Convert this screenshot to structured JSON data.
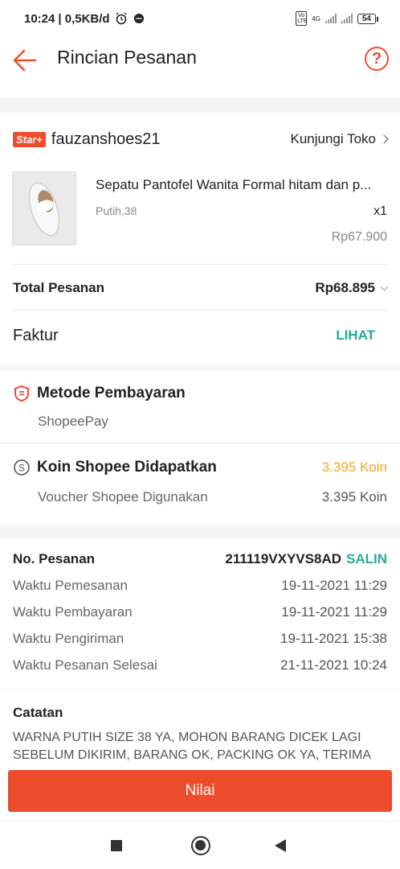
{
  "status_bar": {
    "time": "10:24",
    "speed": "| 0,5KB/d",
    "network": "4G",
    "volte": "Vo LTE",
    "battery": "54"
  },
  "app_bar": {
    "title": "Rincian Pesanan",
    "help": "?"
  },
  "shop": {
    "badge": "Star+",
    "name": "fauzanshoes21",
    "visit_label": "Kunjungi Toko"
  },
  "product": {
    "name": "Sepatu Pantofel Wanita Formal hitam dan p...",
    "variant": "Putih,38",
    "quantity": "x1",
    "price": "Rp67.900"
  },
  "total": {
    "label": "Total Pesanan",
    "value": "Rp68.895"
  },
  "invoice": {
    "label": "Faktur",
    "action": "LIHAT"
  },
  "payment": {
    "title": "Metode Pembayaran",
    "method": "ShopeePay"
  },
  "coins": {
    "title": "Koin Shopee Didapatkan",
    "earned": "3.395 Koin",
    "voucher_label": "Voucher Shopee Digunakan",
    "voucher_value": "3.395 Koin"
  },
  "order_info": {
    "number_label": "No. Pesanan",
    "number_value": "211119VXYVS8AD",
    "copy_label": "SALIN",
    "rows": [
      {
        "label": "Waktu Pemesanan",
        "value": "19-11-2021 11:29"
      },
      {
        "label": "Waktu Pembayaran",
        "value": "19-11-2021 11:29"
      },
      {
        "label": "Waktu Pengiriman",
        "value": "19-11-2021 15:38"
      },
      {
        "label": "Waktu Pesanan Selesai",
        "value": "21-11-2021 10:24"
      }
    ]
  },
  "notes": {
    "title": "Catatan",
    "text": "WARNA PUTIH SIZE  38 YA, MOHON BARANG DICEK LAGI SEBELUM DIKIRIM, BARANG OK, PACKING OK YA, TERIMA"
  },
  "action": {
    "rate_label": "Nilai"
  },
  "colors": {
    "brand": "#ee4d2d",
    "teal": "#26aa99",
    "coin": "#f5a623"
  }
}
